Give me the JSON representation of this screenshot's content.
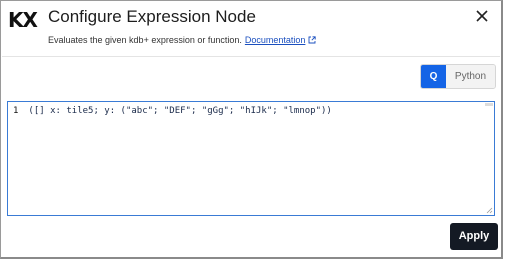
{
  "app": {
    "logo_text": "KX"
  },
  "dialog": {
    "title": "Configure Expression Node",
    "subtitle": "Evaluates the given kdb+ expression or function.",
    "doc_link": "Documentation",
    "close_icon": "close-icon"
  },
  "language_toggle": {
    "options": [
      "Q",
      "Python"
    ],
    "selected": "Q"
  },
  "editor": {
    "line_number": "1",
    "code": "([] x: tile5; y: (\"abc\"; \"DEF\"; \"gGg\"; \"hIJk\"; \"lmnop\"))"
  },
  "footer": {
    "apply_label": "Apply"
  },
  "colors": {
    "accent": "#1464e6",
    "apply_bg": "#141a24",
    "editor_border": "#3a7bd5",
    "link": "#1a4fbf"
  }
}
